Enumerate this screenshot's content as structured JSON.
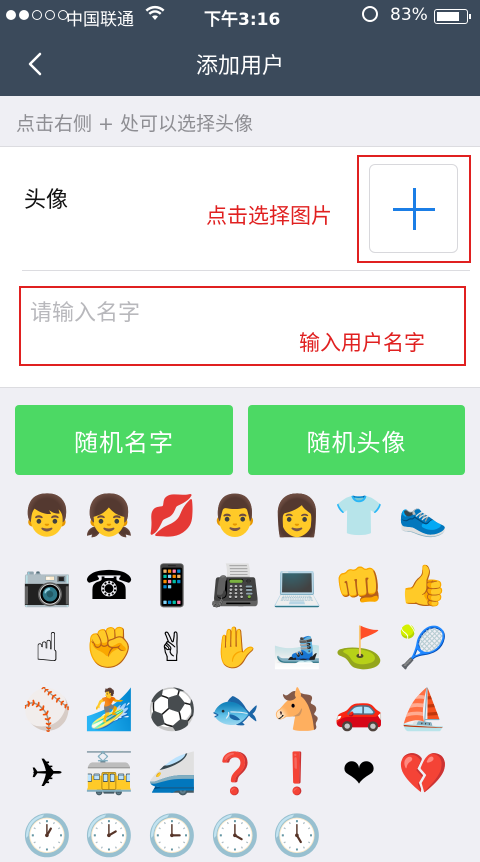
{
  "status_bar": {
    "carrier": "中国联通",
    "time": "下午3:16",
    "battery_percent": "83%",
    "battery_level": 0.83,
    "signal_bars": 2,
    "wifi_icon": "wifi-icon",
    "lock_icon": "rotation-lock-icon"
  },
  "nav": {
    "title": "添加用户",
    "back_icon": "chevron-left-icon"
  },
  "hint": "点击右侧 + 处可以选择头像",
  "form": {
    "avatar_label": "头像",
    "pick_annotation": "点击选择图片",
    "name_placeholder": "请输入名字",
    "name_value": "",
    "name_annotation": "输入用户名字"
  },
  "buttons": {
    "random_name": "随机名字",
    "random_avatar": "随机头像"
  },
  "emojis": [
    {
      "name": "boy-emoji",
      "char": "👦"
    },
    {
      "name": "girl-emoji",
      "char": "👧"
    },
    {
      "name": "kiss-mark-emoji",
      "char": "💋"
    },
    {
      "name": "man-emoji",
      "char": "👨"
    },
    {
      "name": "woman-emoji",
      "char": "👩"
    },
    {
      "name": "shirt-emoji",
      "char": "👕"
    },
    {
      "name": "shoe-emoji",
      "char": "👟"
    },
    {
      "name": "camera-emoji",
      "char": "📷"
    },
    {
      "name": "telephone-emoji",
      "char": "☎"
    },
    {
      "name": "mobile-phone-emoji",
      "char": "📱"
    },
    {
      "name": "fax-emoji",
      "char": "📠"
    },
    {
      "name": "computer-emoji",
      "char": "💻"
    },
    {
      "name": "fist-emoji",
      "char": "👊"
    },
    {
      "name": "thumbs-up-emoji",
      "char": "👍"
    },
    {
      "name": "point-up-emoji",
      "char": "☝"
    },
    {
      "name": "raised-fist-emoji",
      "char": "✊"
    },
    {
      "name": "victory-hand-emoji",
      "char": "✌"
    },
    {
      "name": "raised-hand-emoji",
      "char": "✋"
    },
    {
      "name": "ski-emoji",
      "char": "🎿"
    },
    {
      "name": "golf-emoji",
      "char": "⛳"
    },
    {
      "name": "tennis-emoji",
      "char": "🎾"
    },
    {
      "name": "baseball-emoji",
      "char": "⚾"
    },
    {
      "name": "surfer-emoji",
      "char": "🏄"
    },
    {
      "name": "soccer-ball-emoji",
      "char": "⚽"
    },
    {
      "name": "fish-emoji",
      "char": "🐟"
    },
    {
      "name": "horse-emoji",
      "char": "🐴"
    },
    {
      "name": "car-emoji",
      "char": "🚗"
    },
    {
      "name": "sailboat-emoji",
      "char": "⛵"
    },
    {
      "name": "airplane-emoji",
      "char": "✈"
    },
    {
      "name": "tram-emoji",
      "char": "🚋"
    },
    {
      "name": "train-emoji",
      "char": "🚄"
    },
    {
      "name": "question-mark-emoji",
      "char": "❓"
    },
    {
      "name": "exclamation-mark-emoji",
      "char": "❗"
    },
    {
      "name": "heart-emoji",
      "char": "❤"
    },
    {
      "name": "broken-heart-emoji",
      "char": "💔"
    },
    {
      "name": "clock-emoji",
      "char": "🕐"
    },
    {
      "name": "clock-emoji",
      "char": "🕑"
    },
    {
      "name": "clock-emoji",
      "char": "🕒"
    },
    {
      "name": "clock-emoji",
      "char": "🕓"
    },
    {
      "name": "clock-emoji",
      "char": "🕔"
    }
  ]
}
